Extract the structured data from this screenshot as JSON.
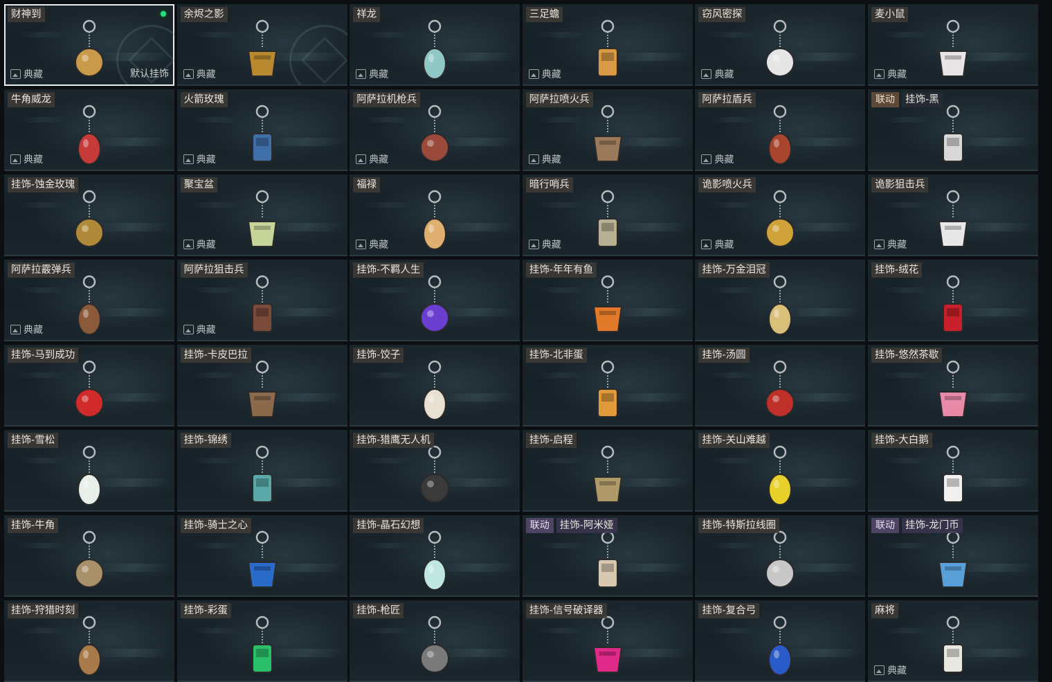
{
  "cards": [
    {
      "name": "财神到",
      "collection": "典藏",
      "default_label": "默认挂饰",
      "equipped": true,
      "icon": "fortune-god-charm-icon",
      "color": "#c89a4a"
    },
    {
      "name": "余烬之影",
      "collection": "典藏",
      "icon": "ember-shadow-charm-icon",
      "color": "#b9892f"
    },
    {
      "name": "祥龙",
      "collection": "典藏",
      "icon": "auspicious-dragon-charm-icon",
      "color": "#8fc8c4"
    },
    {
      "name": "三足蟾",
      "collection": "典藏",
      "icon": "three-legged-toad-charm-icon",
      "color": "#d89a45"
    },
    {
      "name": "窃风密探",
      "collection": "典藏",
      "icon": "wind-spy-charm-icon",
      "color": "#e6e6e6"
    },
    {
      "name": "麦小鼠",
      "collection": "典藏",
      "icon": "mouse-charm-icon",
      "color": "#e8e4e6"
    },
    {
      "name": "牛角威龙",
      "collection": "典藏",
      "icon": "horned-dragon-charm-icon",
      "color": "#c63a3a"
    },
    {
      "name": "火箭玫瑰",
      "collection": "典藏",
      "icon": "rocket-rose-charm-icon",
      "color": "#3f6fa8"
    },
    {
      "name": "阿萨拉机枪兵",
      "collection": "典藏",
      "icon": "asala-gunner-charm-icon",
      "color": "#9a4a3a"
    },
    {
      "name": "阿萨拉喷火兵",
      "collection": "典藏",
      "icon": "asala-flamer-charm-icon",
      "color": "#9a7a5a"
    },
    {
      "name": "阿萨拉盾兵",
      "collection": "典藏",
      "icon": "asala-shield-charm-icon",
      "color": "#a8452f"
    },
    {
      "collab": "联动",
      "collab_style": "alt",
      "name": "挂饰-黑",
      "icon": "black-card-charm-icon",
      "color": "#d8d8d8"
    },
    {
      "name": "挂饰-蚀金玫瑰",
      "icon": "gold-rose-charm-icon",
      "color": "#b08a3a"
    },
    {
      "name": "聚宝盆",
      "collection": "典藏",
      "icon": "treasure-bowl-charm-icon",
      "color": "#c6d69a"
    },
    {
      "name": "福禄",
      "collection": "典藏",
      "icon": "fortune-gourd-charm-icon",
      "color": "#e0b070"
    },
    {
      "name": "暗行哨兵",
      "collection": "典藏",
      "icon": "shadow-sentry-charm-icon",
      "color": "#b8b092"
    },
    {
      "name": "诡影喷火兵",
      "collection": "典藏",
      "icon": "phantom-flamer-charm-icon",
      "color": "#d0a23a"
    },
    {
      "name": "诡影狙击兵",
      "collection": "典藏",
      "icon": "phantom-sniper-charm-icon",
      "color": "#e8e8e8"
    },
    {
      "name": "阿萨拉霰弹兵",
      "collection": "典藏",
      "icon": "asala-shotgunner-charm-icon",
      "color": "#8a5a3a"
    },
    {
      "name": "阿萨拉狙击兵",
      "collection": "典藏",
      "icon": "asala-sniper-charm-icon",
      "color": "#7a4a3a"
    },
    {
      "name": "挂饰-不羁人生",
      "icon": "sneaker-charm-icon",
      "color": "#6a3fd0"
    },
    {
      "name": "挂饰-年年有鱼",
      "icon": "fish-charm-icon",
      "color": "#e07a2a"
    },
    {
      "name": "挂饰-万金泪冠",
      "icon": "gold-crown-charm-icon",
      "color": "#d8c07a"
    },
    {
      "name": "挂饰-绒花",
      "icon": "velvet-flower-charm-icon",
      "color": "#c8202a"
    },
    {
      "name": "挂饰-马到成功",
      "icon": "lucky-horse-charm-icon",
      "color": "#d02a2a"
    },
    {
      "name": "挂饰-卡皮巴拉",
      "icon": "capybara-charm-icon",
      "color": "#8a6a4a"
    },
    {
      "name": "挂饰-饺子",
      "icon": "dumpling-charm-icon",
      "color": "#e8e0d0"
    },
    {
      "name": "挂饰-北非蛋",
      "icon": "shakshuka-charm-icon",
      "color": "#e09a3a"
    },
    {
      "name": "挂饰-汤圆",
      "icon": "tangyuan-charm-icon",
      "color": "#c0302a"
    },
    {
      "name": "挂饰-悠然茶歇",
      "icon": "cupcake-charm-icon",
      "color": "#e88aa8"
    },
    {
      "name": "挂饰-雪松",
      "icon": "snow-pine-charm-icon",
      "color": "#e8efe8"
    },
    {
      "name": "挂饰-锦绣",
      "icon": "butterfly-charm-icon",
      "color": "#5aa8a8"
    },
    {
      "name": "挂饰-猎鹰无人机",
      "icon": "falcon-drone-charm-icon",
      "color": "#3a3a3a"
    },
    {
      "name": "挂饰-启程",
      "icon": "compass-charm-icon",
      "color": "#b09a6a"
    },
    {
      "name": "挂饰-关山难越",
      "icon": "lighter-charm-icon",
      "color": "#e8d02a"
    },
    {
      "name": "挂饰-大白鹅",
      "icon": "white-goose-charm-icon",
      "color": "#f0f0ee"
    },
    {
      "name": "挂饰-牛角",
      "icon": "bull-horns-charm-icon",
      "color": "#a8906a"
    },
    {
      "name": "挂饰-骑士之心",
      "icon": "knight-heart-charm-icon",
      "color": "#2a6ac8"
    },
    {
      "name": "挂饰-晶石幻想",
      "icon": "crystal-cube-charm-icon",
      "color": "#bfe6e0"
    },
    {
      "collab": "联动",
      "collab_style": "violet",
      "name": "挂饰-阿米娅",
      "icon": "amiya-charm-icon",
      "color": "#d8c8b0"
    },
    {
      "name": "挂饰-特斯拉线圈",
      "icon": "tesla-coil-charm-icon",
      "color": "#c8c8c8"
    },
    {
      "collab": "联动",
      "collab_style": "violet",
      "name": "挂饰-龙门币",
      "icon": "lungmen-coin-charm-icon",
      "color": "#5aa0d8"
    },
    {
      "name": "挂饰-狩猎时刻",
      "icon": "moose-antlers-charm-icon",
      "color": "#a87a4a"
    },
    {
      "name": "挂饰-彩蛋",
      "icon": "easter-egg-charm-icon",
      "color": "#2ac06a"
    },
    {
      "name": "挂饰-枪匠",
      "icon": "gunsmith-case-charm-icon",
      "color": "#7a7a7a"
    },
    {
      "name": "挂饰-信号破译器",
      "icon": "signal-decoder-charm-icon",
      "color": "#e02a8a"
    },
    {
      "name": "挂饰-复合弓",
      "icon": "compound-bow-charm-icon",
      "color": "#2a5ac8"
    },
    {
      "name": "麻将",
      "collection": "典藏",
      "icon": "mahjong-tile-charm-icon",
      "color": "#e8e8e0"
    }
  ]
}
